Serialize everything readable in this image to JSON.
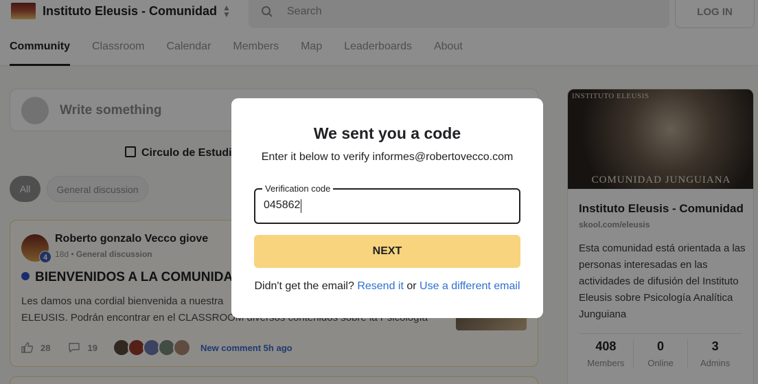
{
  "header": {
    "group_name": "Instituto Eleusis - Comunidad",
    "search_placeholder": "Search",
    "login_label": "LOG IN"
  },
  "tabs": [
    {
      "label": "Community",
      "active": true
    },
    {
      "label": "Classroom"
    },
    {
      "label": "Calendar"
    },
    {
      "label": "Members"
    },
    {
      "label": "Map"
    },
    {
      "label": "Leaderboards"
    },
    {
      "label": "About"
    }
  ],
  "composer": {
    "placeholder": "Write something"
  },
  "event": {
    "label": "Circulo de Estudio"
  },
  "filters": {
    "all": "All",
    "general": "General discussion"
  },
  "post": {
    "author": "Roberto gonzalo Vecco giove",
    "level": "4",
    "age": "18d",
    "category": "General discussion",
    "title": "BIENVENIDOS A LA COMUNIDAD",
    "body_line1": "Les damos una cordial bienvenida a nuestra",
    "body_line2": "ELEUSIS. Podrán encontrar en el CLASSROOM diversos contenidos sobre la Psicología",
    "likes": "28",
    "comments": "19",
    "new_comment": "New comment 5h ago"
  },
  "sidebar": {
    "cover_top": "INSTITUTO ELEUSIS",
    "cover_bottom": "COMUNIDAD JUNGUIANA",
    "title": "Instituto Eleusis - Comunidad",
    "url": "skool.com/eleusis",
    "description": "Esta comunidad está orientada a las personas interesadas en las actividades de difusión del Instituto Eleusis sobre Psicología Analítica Junguiana",
    "stats": [
      {
        "value": "408",
        "label": "Members"
      },
      {
        "value": "0",
        "label": "Online"
      },
      {
        "value": "3",
        "label": "Admins"
      }
    ]
  },
  "modal": {
    "title": "We sent you a code",
    "subtitle": "Enter it below to verify informes@robertovecco.com",
    "field_label": "Verification code",
    "field_value": "045862",
    "next_label": "NEXT",
    "footer_prefix": "Didn't get the email?",
    "resend_label": "Resend it",
    "or_text": "or",
    "different_email_label": "Use a different email"
  },
  "colors": {
    "accent_yellow": "#f8d47f",
    "link_blue": "#2f6fd0",
    "level_badge": "#3c5bb5"
  }
}
